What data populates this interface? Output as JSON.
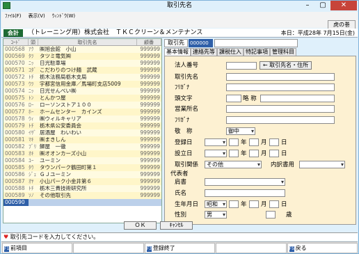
{
  "window": {
    "title": "取引先名",
    "close_glyph": "✕",
    "minimize_glyph": "–",
    "maximize_glyph": "▢"
  },
  "menu": [
    "ﾌｧｲﾙ(F)",
    "表示(V)",
    "ｳｨﾝﾄﾞｳ(W)"
  ],
  "toolbar": {
    "tora_label": "虎の巻"
  },
  "info": {
    "kaikei": "会計",
    "company": "（トレーニング用）株式会社　ＴＫＣクリーン＆メンテナンス",
    "today": "本日：平成28年 7月15日(金)"
  },
  "list": {
    "headers": [
      "ｺｰﾄﾞ",
      "頭",
      "取引先名",
      "顧番"
    ],
    "rows": [
      {
        "code": "000568",
        "head": "ｱｸ",
        "name": "㈱旭会館　小山",
        "num": "999999"
      },
      {
        "code": "000569",
        "head": "ﾀﾂ",
        "name": "タツミ電気㈱",
        "num": "999999"
      },
      {
        "code": "000570",
        "head": "ﾆｯ",
        "name": "日光駐車場",
        "num": "999999"
      },
      {
        "code": "000571",
        "head": "ｺﾀﾞ",
        "name": "こだわりのつけ麺　武蔵",
        "num": "999999"
      },
      {
        "code": "000572",
        "head": "ﾄﾁ",
        "name": "栃木法務局栃木支局",
        "num": "999999"
      },
      {
        "code": "000573",
        "head": "ｳﾂ",
        "name": "宇都宮信用金庫／馬場町支店5009",
        "num": "999999"
      },
      {
        "code": "000574",
        "head": "ﾆｯ",
        "name": "日光せんべい㈱",
        "num": "999999"
      },
      {
        "code": "000575",
        "head": "ﾄﾝ",
        "name": "とんかつ屋",
        "num": "999999"
      },
      {
        "code": "000576",
        "head": "ﾛｰ",
        "name": "ローソンストア１００",
        "num": "999999"
      },
      {
        "code": "000577",
        "head": "ﾎｰ",
        "name": "ホームセンター　カインズ",
        "num": "999999"
      },
      {
        "code": "000578",
        "head": "ｳｨ",
        "name": "㈱ウィルキャリア",
        "num": "999999"
      },
      {
        "code": "000579",
        "head": "ﾄﾁ",
        "name": "栃木県公安委員会",
        "num": "999999"
      },
      {
        "code": "000580",
        "head": "ｲｻﾞ",
        "name": "居酒屋　わいわい",
        "num": "999999"
      },
      {
        "code": "000581",
        "head": "ﾏｷ",
        "name": "㈱まきしん",
        "num": "999999"
      },
      {
        "code": "000582",
        "head": "ﾌﾞﾘ",
        "name": "鰤屋　一徹",
        "num": "999999"
      },
      {
        "code": "000583",
        "head": "ｵｷ",
        "name": "㈱オオンカーズ小山",
        "num": "999999"
      },
      {
        "code": "000584",
        "head": "ﾕｰ",
        "name": "ユーミン",
        "num": "999999"
      },
      {
        "code": "000585",
        "head": "ﾀｳ",
        "name": "タウンパーク鶴田町第１",
        "num": "999999"
      },
      {
        "code": "000586",
        "head": "ｼﾞｪ",
        "name": "ＧＪユーミン",
        "num": "999999"
      },
      {
        "code": "000587",
        "head": "ｵﾔ",
        "name": "小山パーク小金井第６",
        "num": "999999"
      },
      {
        "code": "000588",
        "head": "ﾄﾁ",
        "name": "栃木三貴技術研究所",
        "num": "999999"
      },
      {
        "code": "000589",
        "head": "ｿﾉ",
        "name": "その他取引先",
        "num": "999999"
      },
      {
        "code": "000590",
        "head": "",
        "name": "",
        "num": ""
      }
    ]
  },
  "detail": {
    "code_label": "取引先",
    "code_value": "000000",
    "tabs": [
      "基本情報",
      "連絡先等",
      "課税仕入",
      "特記事項",
      "管理科目"
    ],
    "labels": {
      "houjin": "法人番号",
      "name": "取引先名",
      "kana1": "ﾌﾘｶﾞﾅ",
      "atama": "頭文字",
      "ryaku": "略 称",
      "eigyo": "営業所名",
      "kana2": "ﾌﾘｶﾞﾅ",
      "keisho": "敬　称",
      "toroku": "登録日",
      "setsuritsu": "設立日",
      "kankei": "取引関係",
      "uchiwake": "内訳書用",
      "daihyo": "代表者",
      "katagaki": "肩書",
      "shimei": "氏名",
      "seinen": "生年月日",
      "seibetsu": "性別",
      "nen": "年",
      "tsuki": "月",
      "hi": "日",
      "sai": "歳"
    },
    "values": {
      "keisho": "御中",
      "kankei": "その他",
      "gengo": "昭和",
      "seibetsu": "男"
    },
    "search_button": "← 取引先名・住所",
    "ok": "ＯＫ",
    "cancel": "ｷｬﾝｾﾙ"
  },
  "status": {
    "heart": "♥",
    "message": "取引先コードを入力してください。"
  },
  "fkeys": [
    {
      "key": "F1",
      "label": "前項目"
    },
    {
      "key": "",
      "label": ""
    },
    {
      "key": "F3",
      "label": "登録終了"
    },
    {
      "key": "",
      "label": ""
    },
    {
      "key": "F5",
      "label": "戻る"
    }
  ]
}
